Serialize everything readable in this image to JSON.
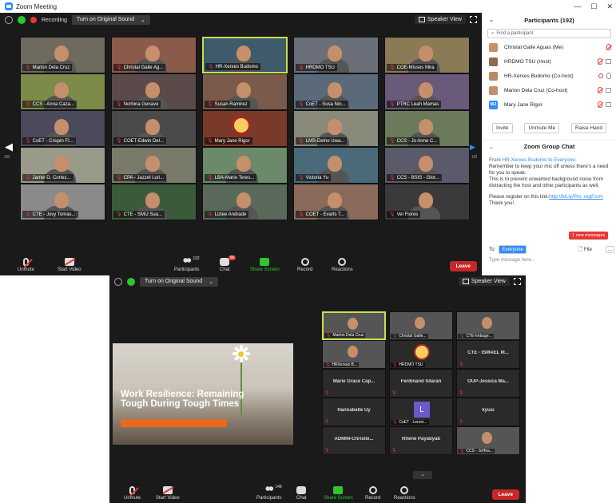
{
  "window": {
    "title": "Zoom Meeting",
    "controls": [
      "—",
      "☐",
      "✕"
    ]
  },
  "top_meeting": {
    "topbar": {
      "recording": "Recording",
      "original_sound": "Turn on Original Sound",
      "view": "Speaker View"
    },
    "page_left": "1/8",
    "page_right": "1/8",
    "tiles": [
      "Marlon Dela Cruz",
      "Christal Galle Ag...",
      "HR-Xerxes Budomo",
      "HRDMO TSU",
      "COE-Misses Mira",
      "CCS - Anna Caza...",
      "Norbina Genave",
      "Susan Ramirez",
      "CoET - Susa Nin...",
      "PTRC Leah Mamas",
      "CoET - Crispin Fl...",
      "COET-Edwin Del...",
      "Mary Jane Rigor",
      "LMS-Delno Uwa...",
      "CCS - Jo Anne C...",
      "Jamie D. Cortez...",
      "CPA - Jazzel Luri...",
      "LBA-Marie Teres...",
      "Victoria Yu",
      "CCS - BSIS - Glor...",
      "CTE - Jovy Tomas...",
      "CTE - SMIJ Sua...",
      "Lizlee Andrade",
      "COET - Evarts T...",
      "Vel Flores"
    ],
    "toolbar": {
      "unmute": "Unmute",
      "start_video": "Start Video",
      "participants": "Participants",
      "participants_count": "192",
      "chat": "Chat",
      "chat_badge": "99",
      "share": "Share Screen",
      "record": "Record",
      "reactions": "Reactions",
      "leave": "Leave"
    }
  },
  "panel": {
    "title": "Participants (192)",
    "search_placeholder": "Find a participant",
    "participants": [
      {
        "name": "Christal Galle Aguas (Me)"
      },
      {
        "name": "HRDMO TSU (Host)"
      },
      {
        "name": "HR-Xerxes Budomo (Co-host)"
      },
      {
        "name": "Marlon Dela Cruz (Co-host)"
      },
      {
        "name": "Mary Jane Rigor",
        "initials": "MJ"
      }
    ],
    "buttons": {
      "invite": "Invite",
      "unmute_me": "Unmute Me",
      "raise_hand": "Raise Hand"
    },
    "chat": {
      "title": "Zoom Group Chat",
      "from_prefix": "From ",
      "sender": "HR-Xerxes Budomo to Everyone",
      "sender_suffix": ":",
      "line1": "Remember to keep your mic off unless there's a need for you to speak.",
      "line2": "This is to prevent unwanted background noise from distracting the host and other participants as well.",
      "line3_prefix": "Please register on this link:",
      "link": "http://bit.ly/Pro_regForm",
      "line4": "Thank you!",
      "new_messages": "1 new messages",
      "to_label": "To:",
      "to_value": "Everyone",
      "file": "File",
      "more": "...",
      "input_placeholder": "Type message here..."
    }
  },
  "bottom_meeting": {
    "original_sound": "Turn on Original Sound",
    "view": "Speaker View",
    "slide": {
      "title": "Work Resilience: Remaining Tough During Tough Times"
    },
    "tiles": [
      {
        "label": "Marlon Dela Cruz",
        "type": "video",
        "active": true
      },
      {
        "label": "Christal Galle...",
        "type": "video"
      },
      {
        "label": "CTE-Imbuge...",
        "type": "video"
      },
      {
        "label": "HRXerxes B...",
        "type": "video"
      },
      {
        "label": "HRDMO TSU",
        "type": "seal"
      },
      {
        "name": "CTE - ISMAEL M...",
        "type": "name"
      },
      {
        "name": "Marie Grace Cap...",
        "type": "name"
      },
      {
        "name": "Ferdinand Silaran",
        "type": "name"
      },
      {
        "name": "OUP-Jessica Ma...",
        "type": "name"
      },
      {
        "name": "Hannabelle Uy",
        "type": "name"
      },
      {
        "label": "CoET - Lereni...",
        "type": "letter",
        "letter": "L"
      },
      {
        "name": "kyusi",
        "type": "name"
      },
      {
        "name": "ADMIN-Christie...",
        "type": "name"
      },
      {
        "name": "Rhene Payabyab",
        "type": "name"
      },
      {
        "label": "CCS - JoHna...",
        "type": "video"
      }
    ],
    "toolbar": {
      "unmute": "Unmute",
      "start_video": "Start Video",
      "participants": "Participants",
      "participants_count": "148",
      "chat": "Chat",
      "share": "Share Screen",
      "record": "Record",
      "reactions": "Reactions",
      "leave": "Leave"
    }
  }
}
